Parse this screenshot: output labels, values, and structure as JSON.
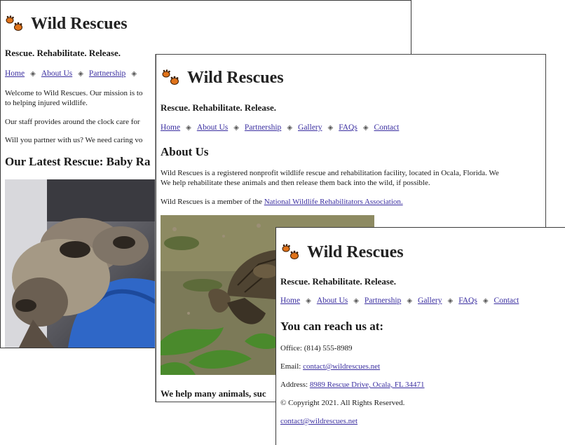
{
  "site": {
    "title": "Wild Rescues",
    "tagline": "Rescue. Rehabilitate. Release.",
    "logo_icon": "paw-prints-icon",
    "colors": {
      "paw": "#e0731a",
      "link": "#3a2ea0",
      "separator": "#555555"
    }
  },
  "nav": {
    "separator_icon": "diamond-icon",
    "items": [
      "Home",
      "About Us",
      "Partnership",
      "Gallery",
      "FAQs",
      "Contact"
    ]
  },
  "home": {
    "intro": "Welcome to Wild Rescues. Our mission is to",
    "intro_cont": "to helping injured wildlife.",
    "staff": "Our staff provides around the clock care for",
    "partner": "Will you partner with us? We need caring vo",
    "heading": "Our Latest Rescue: Baby Ra",
    "photo": "raccoon-photo"
  },
  "about": {
    "heading": "About Us",
    "p1": "Wild Rescues is a registered nonprofit wildlife rescue and rehabilitation facility, located in Ocala, Florida. We",
    "p1_cont": "We help rehabilitate these animals and then release them back into the wild, if possible.",
    "member_prefix": "Wild Rescues is a member of the ",
    "member_link": "National Wildlife Rehabilitators Association.",
    "photo": "tortoise-photo",
    "bottom_heading": "We help many animals, suc"
  },
  "contact": {
    "heading": "You can reach us at:",
    "office": "Office: (814) 555-8989",
    "email_label": "Email: ",
    "email": "contact@wildrescues.net",
    "address_label": "Address: ",
    "address": "8989 Rescue Drive, Ocala, FL 34471",
    "copyright": "© Copyright 2021. All Rights Reserved.",
    "footer_email": "contact@wildrescues.net"
  }
}
